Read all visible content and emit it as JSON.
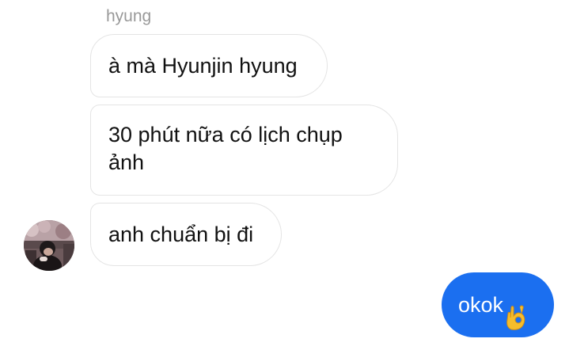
{
  "conversation": {
    "sender_name": "hyung",
    "messages": [
      {
        "text": "à mà Hyunjin hyung",
        "direction": "incoming"
      },
      {
        "text": "30 phút nữa có lịch chụp ảnh",
        "direction": "incoming"
      },
      {
        "text": "anh chuẩn bị đi",
        "direction": "incoming"
      },
      {
        "text": "okok",
        "direction": "outgoing",
        "emoji": "ok-hand-icon"
      }
    ]
  },
  "colors": {
    "outgoing_bubble": "#1b6ff0",
    "incoming_border": "#e4e4e4",
    "sender_name": "#999999",
    "background": "#ffffff"
  }
}
